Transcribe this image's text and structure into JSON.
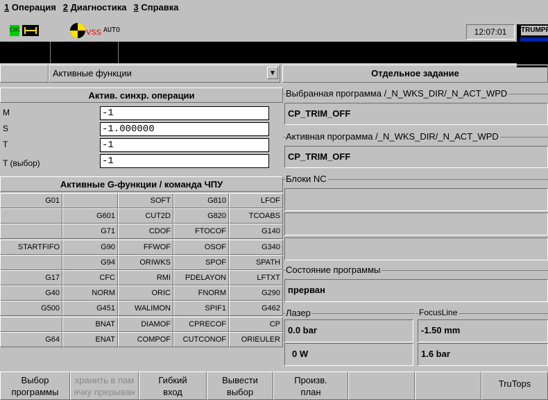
{
  "menu": {
    "item1_num": "1",
    "item1_label": "Операция",
    "item2_num": "2",
    "item2_label": "Диагностика",
    "item3_num": "3",
    "item3_label": "Справка"
  },
  "status": {
    "ok_label": "OK",
    "vss_label": "VSS",
    "mode_label": "AUTO",
    "clock": "12:07:01",
    "brand": "TRUMPF"
  },
  "dropdown": {
    "value": "Активные функции",
    "arrow": "▼"
  },
  "task_title": "Отдельное задание",
  "sync": {
    "title": "Актив. синхр. операции",
    "rows": [
      {
        "label": "M",
        "value": "-1"
      },
      {
        "label": "S",
        "value": "-1.000000"
      },
      {
        "label": "T",
        "value": "-1"
      },
      {
        "label": "T (выбор)",
        "value": "-1"
      }
    ]
  },
  "gfunc": {
    "title": "Активные G-функции / команда ЧПУ",
    "rows": [
      [
        "G01",
        "",
        "SOFT",
        "G810",
        "LFOF"
      ],
      [
        "",
        "G601",
        "CUT2D",
        "G820",
        "TCOABS"
      ],
      [
        "",
        "G71",
        "CDOF",
        "FTOCOF",
        "G140"
      ],
      [
        "STARTFIFO",
        "G90",
        "FFWOF",
        "OSOF",
        "G340"
      ],
      [
        "",
        "G94",
        "ORIWKS",
        "SPOF",
        "SPATH"
      ],
      [
        "G17",
        "CFC",
        "RMI",
        "PDELAYON",
        "LFTXT"
      ],
      [
        "G40",
        "NORM",
        "ORIC",
        "FNORM",
        "G290"
      ],
      [
        "G500",
        "G451",
        "WALIMON",
        "SPIF1",
        "G462"
      ],
      [
        "",
        "BNAT",
        "DIAMOF",
        "CPRECOF",
        "CP"
      ],
      [
        "G64",
        "ENAT",
        "COMPOF",
        "CUTCONOF",
        "ORIEULER"
      ]
    ]
  },
  "right": {
    "selected_program_label": "Выбранная программа /_N_WKS_DIR/_N_ACT_WPD",
    "selected_program_value": "CP_TRIM_OFF",
    "active_program_label": "Активная программа /_N_WKS_DIR/_N_ACT_WPD",
    "active_program_value": "CP_TRIM_OFF",
    "nc_blocks_label": "Блоки NC",
    "program_state_label": "Состояние программы",
    "program_state_value": "прерван",
    "laser_label": "Лазер",
    "laser_pressure": "0.0 bar",
    "laser_power": "0 W",
    "focusline_label": "FocusLine",
    "focus_position": "-1.50 mm",
    "focus_pressure": "1.6 bar"
  },
  "softkeys": [
    {
      "line1": "Выбор",
      "line2": "программы"
    },
    {
      "line1": "хранить в пам",
      "line2": "ячку прерыван"
    },
    {
      "line1": "Гибкий",
      "line2": "вход"
    },
    {
      "line1": "Вывести",
      "line2": "выбор"
    },
    {
      "line1": "Произв.",
      "line2": "план"
    },
    {
      "line1": "",
      "line2": ""
    },
    {
      "line1": "",
      "line2": ""
    },
    {
      "line1": "TruTops",
      "line2": ""
    }
  ]
}
